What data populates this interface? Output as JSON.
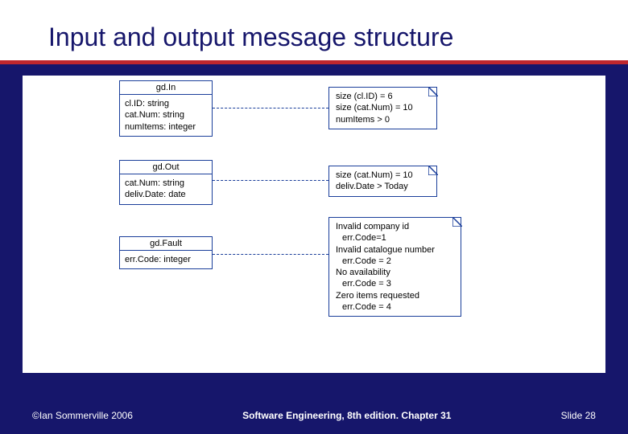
{
  "slide": {
    "title": "Input and output message structure",
    "copyright": "©Ian Sommerville 2006",
    "book": "Software Engineering, 8th edition. Chapter 31",
    "slide_label": "Slide ",
    "slide_number": "28"
  },
  "boxes": {
    "gdIn": {
      "name": "gd.In",
      "attrs": [
        "cl.ID: string",
        "cat.Num: string",
        "numItems: integer"
      ]
    },
    "gdOut": {
      "name": "gd.Out",
      "attrs": [
        "cat.Num: string",
        "deliv.Date: date"
      ]
    },
    "gdFault": {
      "name": "gd.Fault",
      "attrs": [
        "err.Code: integer"
      ]
    }
  },
  "notes": {
    "n1": [
      "size (cl.ID) = 6",
      "size (cat.Num) = 10",
      "numItems > 0"
    ],
    "n2": [
      "size (cat.Num) = 10",
      "deliv.Date > Today"
    ],
    "n3": [
      "Invalid company id",
      "  err.Code=1",
      "Invalid catalogue number",
      "  err.Code = 2",
      "No availability",
      "  err.Code = 3",
      "Zero items requested",
      "  err.Code = 4"
    ]
  }
}
